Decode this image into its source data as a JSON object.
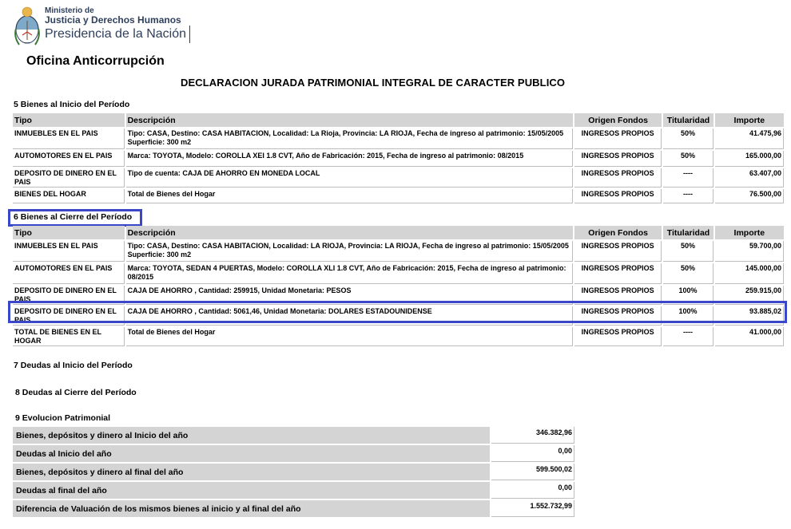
{
  "header": {
    "ministry_line1": "Ministerio de",
    "ministry_line2": "Justicia y Derechos Humanos",
    "ministry_line3": "Presidencia de la Nación",
    "office": "Oficina Anticorrupción",
    "title": "DECLARACION JURADA PATRIMONIAL INTEGRAL DE CARACTER PUBLICO"
  },
  "columns": {
    "tipo": "Tipo",
    "descripcion": "Descripción",
    "origen": "Origen Fondos",
    "titularidad": "Titularidad",
    "importe": "Importe"
  },
  "section5": {
    "title": "5 Bienes al Inicio del Período",
    "rows": [
      {
        "tipo": "INMUEBLES EN EL PAIS",
        "descripcion": "Tipo: CASA, Destino: CASA HABITACION, Localidad: La Rioja, Provincia: LA RIOJA, Fecha de ingreso al patrimonio: 15/05/2005 Superficie: 300 m2",
        "origen": "INGRESOS PROPIOS",
        "titularidad": "50%",
        "importe": "41.475,96"
      },
      {
        "tipo": "AUTOMOTORES EN EL PAIS",
        "descripcion": "Marca: TOYOTA, Modelo: COROLLA XEI 1.8 CVT, Año de Fabricación: 2015, Fecha de ingreso al patrimonio: 08/2015",
        "origen": "INGRESOS PROPIOS",
        "titularidad": "50%",
        "importe": "165.000,00"
      },
      {
        "tipo": "DEPOSITO DE DINERO EN EL PAIS",
        "descripcion": "Tipo de cuenta: CAJA DE AHORRO EN MONEDA LOCAL",
        "origen": "INGRESOS PROPIOS",
        "titularidad": "----",
        "importe": "63.407,00"
      },
      {
        "tipo": "BIENES DEL HOGAR",
        "descripcion": "Total de Bienes del Hogar",
        "origen": "INGRESOS PROPIOS",
        "titularidad": "----",
        "importe": "76.500,00"
      }
    ]
  },
  "section6": {
    "title": "6 Bienes al Cierre del Período",
    "rows": [
      {
        "tipo": "INMUEBLES EN EL PAIS",
        "descripcion": "Tipo: CASA, Destino: CASA HABITACION, Localidad: LA RIOJA, Provincia: LA RIOJA, Fecha de ingreso al patrimonio: 15/05/2005 Superficie: 300 m2",
        "origen": "INGRESOS PROPIOS",
        "titularidad": "50%",
        "importe": "59.700,00"
      },
      {
        "tipo": "AUTOMOTORES EN EL PAIS",
        "descripcion": "Marca: TOYOTA, SEDAN 4 PUERTAS, Modelo: COROLLA XLI 1.8 CVT, Año de Fabricación: 2015, Fecha de ingreso al patrimonio: 08/2015",
        "origen": "INGRESOS PROPIOS",
        "titularidad": "50%",
        "importe": "145.000,00"
      },
      {
        "tipo": "DEPOSITO DE DINERO EN EL PAIS",
        "descripcion": "CAJA DE AHORRO , Cantidad: 259915, Unidad Monetaria: PESOS",
        "origen": "INGRESOS PROPIOS",
        "titularidad": "100%",
        "importe": "259.915,00"
      },
      {
        "tipo": "DEPOSITO DE DINERO EN EL PAIS",
        "descripcion": "CAJA DE AHORRO , Cantidad: 5061,46, Unidad Monetaria: DOLARES ESTADOUNIDENSE",
        "origen": "INGRESOS PROPIOS",
        "titularidad": "100%",
        "importe": "93.885,02"
      },
      {
        "tipo": "TOTAL DE BIENES EN EL HOGAR",
        "descripcion": "Total de Bienes del Hogar",
        "origen": "INGRESOS PROPIOS",
        "titularidad": "----",
        "importe": "41.000,00"
      }
    ]
  },
  "section7": {
    "title": "7 Deudas al Inicio del Período"
  },
  "section8": {
    "title": "8 Deudas al Cierre del Período"
  },
  "section9": {
    "title": "9 Evolucion Patrimonial",
    "rows": [
      {
        "label": "Bienes, depósitos y dinero al Inicio del año",
        "value": "346.382,96"
      },
      {
        "label": "Deudas al Inicio del año",
        "value": "0,00"
      },
      {
        "label": "Bienes, depósitos y dinero al final del año",
        "value": "599.500,02"
      },
      {
        "label": "Deudas al final del año",
        "value": "0,00"
      },
      {
        "label": "Diferencia de Valuación de los mismos bienes al inicio y al final del año",
        "value": "1.552.732,99"
      }
    ]
  },
  "colors": {
    "highlight": "#3b47c9",
    "header_bg": "#d4d4d4",
    "ministry_text": "#2e3f5c"
  }
}
